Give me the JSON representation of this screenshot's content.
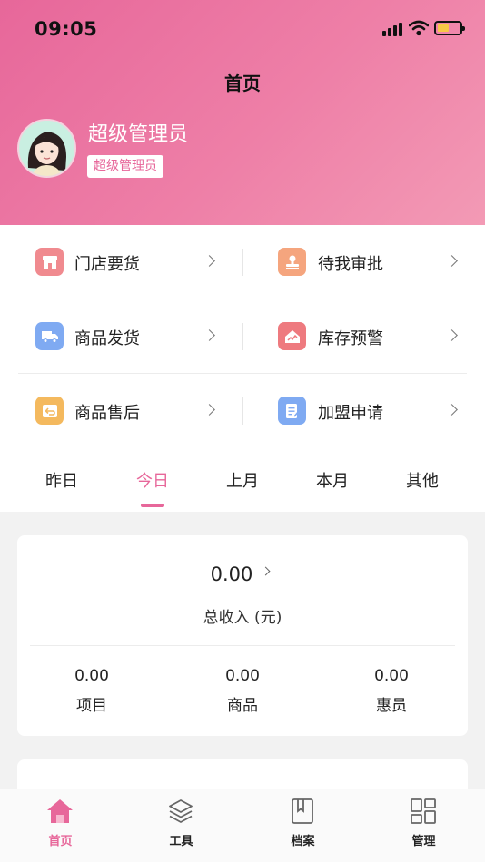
{
  "status_bar": {
    "time": "09:05"
  },
  "header": {
    "title": "首页",
    "user_name": "超级管理员",
    "user_role": "超级管理员"
  },
  "menu": {
    "items": [
      {
        "label": "门店要货",
        "icon": "store-icon",
        "color": "#f08a8f"
      },
      {
        "label": "待我审批",
        "icon": "stamp-icon",
        "color": "#f5a57e"
      },
      {
        "label": "商品发货",
        "icon": "truck-icon",
        "color": "#7faaf2"
      },
      {
        "label": "库存预警",
        "icon": "warning-chart-icon",
        "color": "#ee7a7f"
      },
      {
        "label": "商品售后",
        "icon": "return-icon",
        "color": "#f4b95e"
      },
      {
        "label": "加盟申请",
        "icon": "application-icon",
        "color": "#7faaf2"
      }
    ]
  },
  "tabs": {
    "items": [
      "昨日",
      "今日",
      "上月",
      "本月",
      "其他"
    ],
    "active_index": 1
  },
  "summary": {
    "total_value": "0.00",
    "total_label": "总收入 (元)",
    "stats": [
      {
        "value": "0.00",
        "label": "项目"
      },
      {
        "value": "0.00",
        "label": "商品"
      },
      {
        "value": "0.00",
        "label": "惠员"
      }
    ]
  },
  "tabbar": {
    "items": [
      {
        "label": "首页",
        "icon": "home-icon"
      },
      {
        "label": "工具",
        "icon": "layers-icon"
      },
      {
        "label": "档案",
        "icon": "book-icon"
      },
      {
        "label": "管理",
        "icon": "dashboard-icon"
      }
    ],
    "active_index": 0
  },
  "colors": {
    "accent": "#e7679a"
  }
}
